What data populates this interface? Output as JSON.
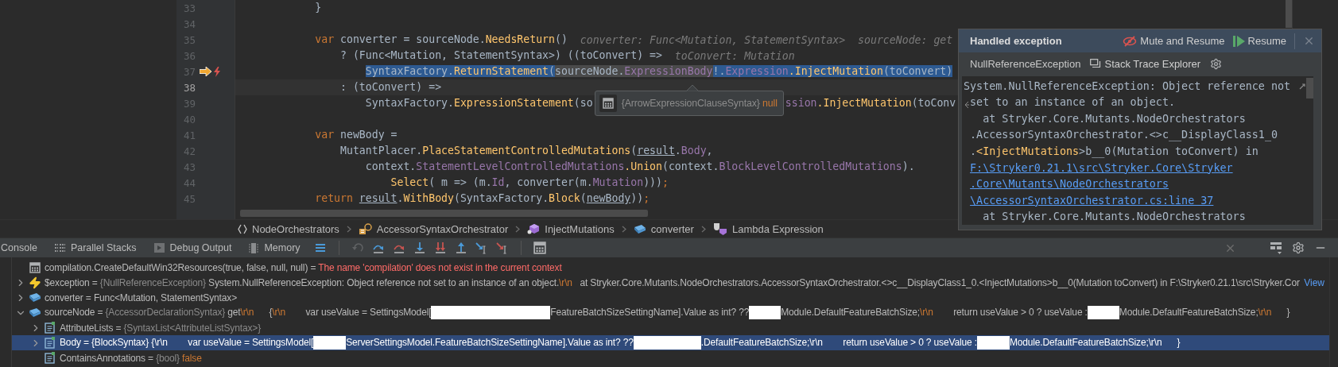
{
  "editor": {
    "lines": [
      {
        "number": "33",
        "current": false,
        "tokens": [
          {
            "kind": "plain",
            "text": "            }"
          }
        ]
      },
      {
        "number": "34",
        "current": false
      },
      {
        "number": "35",
        "current": false,
        "tokens": [
          {
            "kind": "keyword",
            "text": "            var"
          },
          {
            "kind": "plain",
            "text": " converter = sourceNode."
          },
          {
            "kind": "method",
            "text": "NeedsReturn"
          },
          {
            "kind": "plain",
            "text": "()"
          },
          {
            "kind": "hint",
            "text": "converter: Func<Mutation, StatementSyntax>"
          },
          {
            "kind": "hint",
            "text": "sourceNode: get"
          }
        ]
      },
      {
        "number": "36",
        "current": false,
        "tokens": [
          {
            "kind": "plain",
            "text": "                ? (Func<Mutation, StatementSyntax>) ((toConvert) =>"
          },
          {
            "kind": "hint",
            "text": "toConvert: Mutation"
          }
        ]
      },
      {
        "number": "37",
        "current": false,
        "execution_point": true,
        "exception_thrown": true,
        "tokens": [
          {
            "kind": "plain",
            "text": "                    SyntaxFactory.",
            "selected": true
          },
          {
            "kind": "method",
            "text": "ReturnStatement",
            "selected": true
          },
          {
            "kind": "plain",
            "text": "(",
            "selected": true
          },
          {
            "kind": "plain",
            "text": "sourceNode.",
            "evaluated": true
          },
          {
            "kind": "property",
            "text": "ExpressionBody",
            "evaluated": true
          },
          {
            "kind": "plain",
            "text": "!.",
            "selected": true
          },
          {
            "kind": "property",
            "text": "Expression",
            "selected": true
          },
          {
            "kind": "method",
            "text": ".InjectMutation",
            "selected": true
          },
          {
            "kind": "plain",
            "text": "(toConvert)",
            "selected": true
          }
        ]
      },
      {
        "number": "38",
        "current": true,
        "tokens": [
          {
            "kind": "plain",
            "text": "                : (toConvert) =>"
          }
        ]
      },
      {
        "number": "39",
        "current": false,
        "tokens": [
          {
            "kind": "plain",
            "text": "                    SyntaxFactory."
          },
          {
            "kind": "method",
            "text": "ExpressionStatement"
          },
          {
            "kind": "plain",
            "text": "(so"
          }
        ],
        "tooltip": {
          "type": "{ArrowExpressionClauseSyntax}",
          "value": "null"
        },
        "after": [
          {
            "kind": "property",
            "text": "ssion"
          },
          {
            "kind": "method",
            "text": ".InjectMutation"
          },
          {
            "kind": "plain",
            "text": "(toConv"
          }
        ]
      },
      {
        "number": "40",
        "current": false
      },
      {
        "number": "41",
        "current": false,
        "tokens": [
          {
            "kind": "keyword",
            "text": "            var"
          },
          {
            "kind": "plain",
            "text": " newBody ="
          }
        ]
      },
      {
        "number": "42",
        "current": false,
        "tokens": [
          {
            "kind": "plain",
            "text": "                MutantPlacer."
          },
          {
            "kind": "method",
            "text": "PlaceStatementControlledMutations"
          },
          {
            "kind": "plain",
            "text": "("
          },
          {
            "kind": "plain",
            "text": "result",
            "underline": true
          },
          {
            "kind": "plain",
            "text": "."
          },
          {
            "kind": "property",
            "text": "Body"
          },
          {
            "kind": "plain",
            "text": ","
          }
        ]
      },
      {
        "number": "43",
        "current": false,
        "tokens": [
          {
            "kind": "plain",
            "text": "                    context."
          },
          {
            "kind": "property",
            "text": "StatementLevelControlledMutations"
          },
          {
            "kind": "method",
            "text": ".Union"
          },
          {
            "kind": "plain",
            "text": "(context."
          },
          {
            "kind": "property",
            "text": "BlockLevelControlledMutations"
          },
          {
            "kind": "plain",
            "text": ")."
          }
        ]
      },
      {
        "number": "44",
        "current": false,
        "tokens": [
          {
            "kind": "method",
            "text": "                        Select"
          },
          {
            "kind": "plain",
            "text": "( m => (m."
          },
          {
            "kind": "property",
            "text": "Id"
          },
          {
            "kind": "plain",
            "text": ", converter(m."
          },
          {
            "kind": "property",
            "text": "Mutation"
          },
          {
            "kind": "plain",
            "text": ")))"
          },
          {
            "kind": "keyword",
            "text": ";"
          }
        ]
      },
      {
        "number": "45",
        "current": false,
        "tokens": [
          {
            "kind": "keyword",
            "text": "            return "
          },
          {
            "kind": "plain",
            "text": "result",
            "underline": true
          },
          {
            "kind": "plain",
            "text": "."
          },
          {
            "kind": "method",
            "text": "WithBody"
          },
          {
            "kind": "plain",
            "text": "(SyntaxFactory."
          },
          {
            "kind": "method",
            "text": "Block"
          },
          {
            "kind": "plain",
            "text": "("
          },
          {
            "kind": "plain",
            "text": "newBody",
            "underline": true
          },
          {
            "kind": "plain",
            "text": "))"
          },
          {
            "kind": "keyword",
            "text": ";"
          }
        ]
      }
    ]
  },
  "breadcrumbs": [
    {
      "kind": "namespace",
      "label": "NodeOrchestrators"
    },
    {
      "kind": "class",
      "label": "AccessorSyntaxOrchestrator"
    },
    {
      "kind": "method",
      "label": "InjectMutations"
    },
    {
      "kind": "variable",
      "label": "converter"
    },
    {
      "kind": "lambda",
      "label": "Lambda Expression"
    }
  ],
  "exception_popup": {
    "title": "Handled exception",
    "actions": [
      {
        "kind": "mute",
        "label": "Mute and Resume"
      },
      {
        "kind": "resume",
        "label": "Resume"
      }
    ],
    "exception_type": "NullReferenceException",
    "explorer": "Stack Trace Explorer",
    "trace": [
      {
        "continuation": false,
        "soft_wrapped": true,
        "segments": [
          {
            "kind": "plain",
            "text": "System.NullReferenceException: Object reference not"
          }
        ]
      },
      {
        "continuation": true,
        "wrap_continued": true,
        "segments": [
          {
            "kind": "plain",
            "text": "set to an instance of an object."
          }
        ]
      },
      {
        "continuation": false,
        "segments": [
          {
            "kind": "plain",
            "text": "   at Stryker.Core.Mutants.NodeOrchestrators"
          }
        ]
      },
      {
        "continuation": true,
        "segments": [
          {
            "kind": "plain",
            "text": ".AccessorSyntaxOrchestrator.<>c__DisplayClass1_0"
          }
        ]
      },
      {
        "continuation": true,
        "segments": [
          {
            "kind": "plain",
            "text": "."
          },
          {
            "kind": "method",
            "text": "<InjectMutations"
          },
          {
            "kind": "plain",
            "text": ">b__0(Mutation toConvert) in"
          }
        ]
      },
      {
        "continuation": true,
        "segments": [
          {
            "kind": "link",
            "text": "F:\\Stryker0.21.1\\src\\Stryker.Core\\Stryker"
          }
        ]
      },
      {
        "continuation": true,
        "segments": [
          {
            "kind": "link",
            "text": ".Core\\Mutants\\NodeOrchestrators"
          }
        ]
      },
      {
        "continuation": true,
        "segments": [
          {
            "kind": "link",
            "text": "\\AccessorSyntaxOrchestrator.cs:line 37"
          }
        ]
      },
      {
        "continuation": false,
        "segments": [
          {
            "kind": "plain",
            "text": "   at Stryker.Core.Mutants.NodeOrchestrators"
          }
        ]
      }
    ]
  },
  "debug": {
    "tabs": [
      {
        "label": "Console",
        "selected": false
      },
      {
        "label": "Parallel Stacks",
        "selected": false
      },
      {
        "label": "Debug Output",
        "selected": false
      },
      {
        "label": "Memory",
        "selected": false
      }
    ],
    "actions": [
      {
        "kind": "menu",
        "disabled": false
      },
      {
        "kind": "separator"
      },
      {
        "kind": "back",
        "disabled": true
      },
      {
        "kind": "step-over",
        "disabled": false
      },
      {
        "kind": "force-step-over",
        "disabled": false
      },
      {
        "kind": "step-into",
        "disabled": false
      },
      {
        "kind": "force-step-into",
        "disabled": false
      },
      {
        "kind": "step-out",
        "disabled": false
      },
      {
        "kind": "run-to-cursor",
        "disabled": false
      },
      {
        "kind": "force-run-to-cursor",
        "disabled": false
      },
      {
        "kind": "separator"
      },
      {
        "kind": "evaluate",
        "disabled": false
      }
    ]
  },
  "variables": [
    {
      "kind": "watch",
      "selected": false,
      "segments": [
        {
          "kind": "plain",
          "text": "compilation.CreateDefaultWin32Resources(true, false, null, null) = "
        },
        {
          "kind": "error",
          "text": "The name 'compilation' does not exist in the current context"
        }
      ]
    },
    {
      "kind": "exception",
      "selected": false,
      "expanded": false,
      "segments": [
        {
          "kind": "plain",
          "text": "$exception = "
        },
        {
          "kind": "type",
          "text": "{NullReferenceException}"
        },
        {
          "kind": "plain",
          "text": " System.NullReferenceException: Object reference not set to an instance of an object."
        },
        {
          "kind": "escape",
          "text": "\\r\\n"
        },
        {
          "kind": "plain",
          "text": "   at Stryker.Core.Mutants.NodeOrchestrators.AccessorSyntaxOrchestrator.<>c__DisplayClass1_0.<InjectMutations>b__0(Mutation toConvert) in F:\\Stryker0.21.1\\src\\Stryker.Cor"
        }
      ],
      "link": "View"
    },
    {
      "kind": "variable",
      "selected": false,
      "expanded": false,
      "segments": [
        {
          "kind": "plain",
          "text": "converter = Func<Mutation, StatementSyntax>"
        }
      ]
    },
    {
      "kind": "variable",
      "selected": false,
      "expanded": true,
      "segments": [
        {
          "kind": "plain",
          "text": "sourceNode = "
        },
        {
          "kind": "type",
          "text": "{AccessorDeclarationSyntax}"
        },
        {
          "kind": "plain",
          "text": " get"
        },
        {
          "kind": "escape",
          "text": "\\r\\n"
        },
        {
          "kind": "plain",
          "text": "      {"
        },
        {
          "kind": "escape",
          "text": "\\r\\n"
        },
        {
          "kind": "plain",
          "text": "        var useValue = SettingsModel["
        },
        {
          "kind": "redacted"
        },
        {
          "kind": "plain",
          "text": "FeatureBatchSizeSettingName].Value as int? ??"
        },
        {
          "kind": "redacted"
        },
        {
          "kind": "plain",
          "text": "Module.DefaultFeatureBatchSize;"
        },
        {
          "kind": "escape",
          "text": "\\r\\n"
        },
        {
          "kind": "plain",
          "text": "        return useValue > 0 ? useValue :"
        },
        {
          "kind": "redacted"
        },
        {
          "kind": "plain",
          "text": "Module.DefaultFeatureBatchSize;"
        },
        {
          "kind": "escape",
          "text": "\\r\\n"
        },
        {
          "kind": "plain",
          "text": "      }"
        }
      ],
      "children": [
        {
          "kind": "property",
          "selected": false,
          "expanded": false,
          "segments": [
            {
              "kind": "plain",
              "text": "AttributeLists = "
            },
            {
              "kind": "type",
              "text": "{SyntaxList<AttributeListSyntax>}"
            }
          ]
        },
        {
          "kind": "property",
          "selected": true,
          "expanded": false,
          "segments": [
            {
              "kind": "plain",
              "text": "Body = "
            },
            {
              "kind": "type",
              "text": "{BlockSyntax}"
            },
            {
              "kind": "plain",
              "text": " {"
            },
            {
              "kind": "escape",
              "text": "\\r\\n"
            },
            {
              "kind": "plain",
              "text": "        var useValue = SettingsModel["
            },
            {
              "kind": "redacted"
            },
            {
              "kind": "plain",
              "text": "ServerSettingsModel.FeatureBatchSizeSettingName].Value as int? ??"
            },
            {
              "kind": "redacted"
            },
            {
              "kind": "plain",
              "text": ".DefaultFeatureBatchSize;"
            },
            {
              "kind": "escape",
              "text": "\\r\\n"
            },
            {
              "kind": "plain",
              "text": "        return useValue > 0 ? useValue :"
            },
            {
              "kind": "redacted"
            },
            {
              "kind": "plain",
              "text": "Module.DefaultFeatureBatchSize;"
            },
            {
              "kind": "escape",
              "text": "\\r\\n"
            },
            {
              "kind": "plain",
              "text": "      }"
            }
          ]
        },
        {
          "kind": "property",
          "selected": false,
          "segments": [
            {
              "kind": "plain",
              "text": "ContainsAnnotations = "
            },
            {
              "kind": "type",
              "text": "{bool}"
            },
            {
              "kind": "value",
              "text": " false"
            }
          ]
        }
      ]
    }
  ]
}
